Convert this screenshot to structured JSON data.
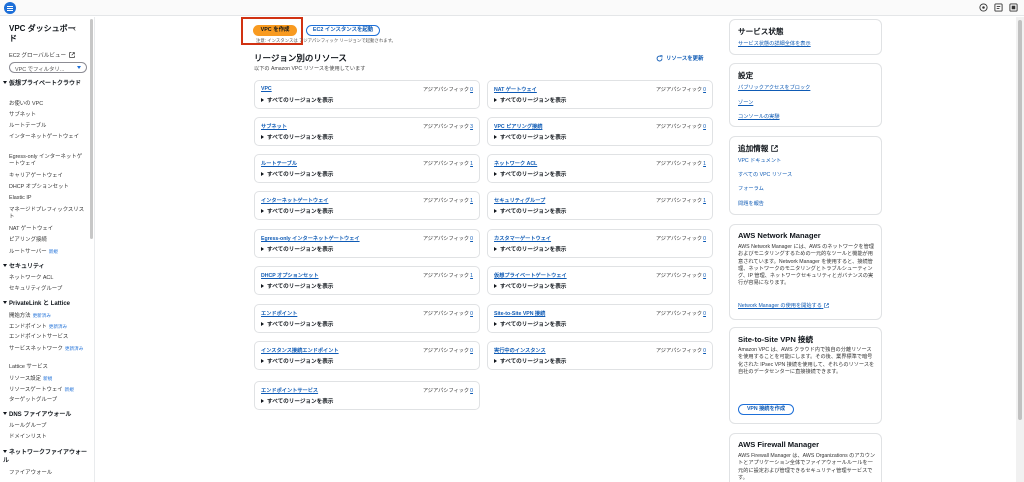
{
  "topbar": {
    "icons": [
      "menu-icon",
      "notifications-icon",
      "settings-icon",
      "help-icon"
    ]
  },
  "sidebar": {
    "title": "VPC ダッシュボード",
    "global_view": "EC2 グローバルビュー",
    "filter_placeholder": "VPC でフィルタリ...",
    "sections": {
      "virtual_cloud": "仮想プライベートクラウド",
      "security": "セキュリティ",
      "privatelink": "PrivateLink と Lattice",
      "dns": "DNS ファイアウォール",
      "network_firewall": "ネットワークファイアウォール"
    },
    "items": {
      "your_vpcs": "お使いの VPC",
      "subnets": "サブネット",
      "route_tables": "ルートテーブル",
      "igw": "インターネットゲートウェイ",
      "egress_igw": "Egress-only インターネットゲートウェイ",
      "carrier_gw": "キャリアゲートウェイ",
      "dhcp": "DHCP オプションセット",
      "eip": "Elastic IP",
      "prefix_lists": "マネージドプレフィックスリスト",
      "nat": "NAT ゲートウェイ",
      "peering": "ピアリング接続",
      "route_server": "ルートサーバー",
      "nacl": "ネットワーク ACL",
      "sg": "セキュリティグループ",
      "getting_started": "開始方法",
      "endpoints": "エンドポイント",
      "endpoint_services": "エンドポイントサービス",
      "service_networks": "サービスネットワーク",
      "lattice_services": "Lattice サービス",
      "resource_config": "リソース設定",
      "resource_gw": "リソースゲートウェイ",
      "target_groups": "ターゲットグループ",
      "rule_groups": "ルールグループ",
      "domain_lists": "ドメインリスト",
      "firewalls": "ファイアウォール"
    },
    "badges": {
      "new": "新規",
      "updated": "更新済み"
    }
  },
  "main": {
    "create_vpc": "VPC を作成",
    "launch_ec2": "EC2 インスタンスを起動",
    "note": "注意: インスタンスは アジアパシフィック リージョンで起動されます。",
    "resources_title": "リージョン別のリソース",
    "resources_sub": "以下の Amazon VPC リソースを使用しています",
    "refresh": "リソースを更新",
    "region_label": "アジアパシフィック",
    "show_all": "すべてのリージョンを表示",
    "left_resources": [
      {
        "name": "VPC",
        "count": "0"
      },
      {
        "name": "サブネット",
        "count": "3"
      },
      {
        "name": "ルートテーブル",
        "count": "1"
      },
      {
        "name": "インターネットゲートウェイ",
        "count": "1"
      },
      {
        "name": "Egress-only インターネットゲートウェイ",
        "count": "0"
      },
      {
        "name": "DHCP オプションセット",
        "count": "1"
      },
      {
        "name": "エンドポイント",
        "count": "0"
      },
      {
        "name": "インスタンス接続エンドポイント",
        "count": "0"
      },
      {
        "name": "エンドポイントサービス",
        "count": "0"
      }
    ],
    "right_resources": [
      {
        "name": "NAT ゲートウェイ",
        "count": "0"
      },
      {
        "name": "VPC ピアリング接続",
        "count": "0"
      },
      {
        "name": "ネットワーク ACL",
        "count": "1"
      },
      {
        "name": "セキュリティグループ",
        "count": "1"
      },
      {
        "name": "カスタマーゲートウェイ",
        "count": "0"
      },
      {
        "name": "仮想プライベートゲートウェイ",
        "count": "0"
      },
      {
        "name": "Site-to-Site VPN 接続",
        "count": "0"
      },
      {
        "name": "実行中のインスタンス",
        "count": "0"
      }
    ]
  },
  "panels": {
    "service_status": {
      "title": "サービス状態",
      "link": "サービス状態の詳細全体を表示"
    },
    "settings": {
      "title": "設定",
      "links": [
        "パブリックアクセスをブロック",
        "ゾーン",
        "コンソールの実験"
      ]
    },
    "additional": {
      "title": "追加情報",
      "links": [
        "VPC ドキュメント",
        "すべての VPC リソース",
        "フォーラム",
        "問題を報告"
      ]
    },
    "network_manager": {
      "title": "AWS Network Manager",
      "text": "AWS Network Manager には、AWS のネットワークを管理およびモニタリングするための一元的なツールと機能が用意されています。Network Manager を使用すると、接続管理、ネットワークのモニタリングとトラブルシューティング、IP 管理、ネットワークセキュリティとガバナンスの実行が容易になります。",
      "link": "Network Manager の使用を開始する"
    },
    "vpn": {
      "title": "Site-to-Site VPN 接続",
      "text": "Amazon VPC は、AWS クラウド内で独自の分離リソースを使用することを可能にします。その後、業界標準で暗号化された IPsec VPN 接続を使用して、それらのリソースを自社のデータセンターに直接接続できます。",
      "button": "VPN 接続を作成"
    },
    "firewall_manager": {
      "title": "AWS Firewall Manager",
      "text": "AWS Firewall Manager は、AWS Organizations のアカウントとアプリケーション全体でファイアウォールルールを一元的に設定および管理できるセキュリティ管理サービスです。"
    }
  }
}
